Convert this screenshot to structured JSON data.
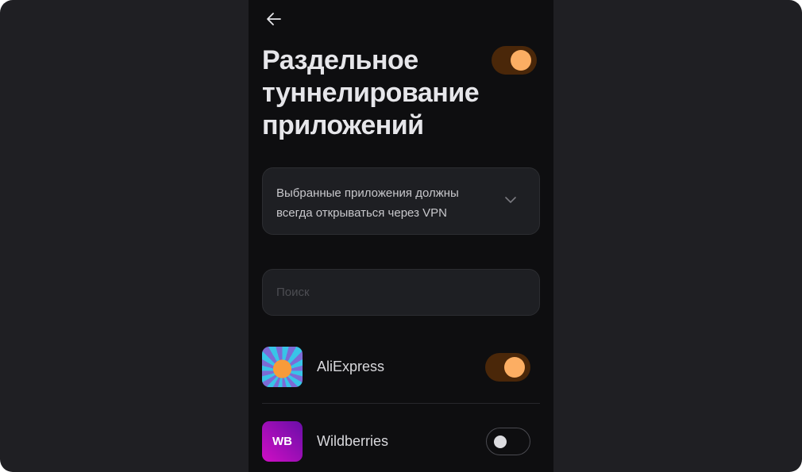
{
  "header": {
    "title": "Раздельное туннелирование приложений",
    "enabled": true
  },
  "mode_select": {
    "value": "Выбранные приложения должны всегда открываться через VPN"
  },
  "search": {
    "placeholder": "Поиск",
    "value": ""
  },
  "apps": [
    {
      "name": "AliExpress",
      "icon": "aliexpress-icon",
      "enabled": true
    },
    {
      "name": "Wildberries",
      "icon": "wildberries-icon",
      "icon_text": "WB",
      "enabled": false
    }
  ],
  "colors": {
    "accent": "#fcae63",
    "toggle_on_track": "#4a2709",
    "panel_bg": "#0e0e10",
    "outer_bg": "#1f1f23"
  }
}
